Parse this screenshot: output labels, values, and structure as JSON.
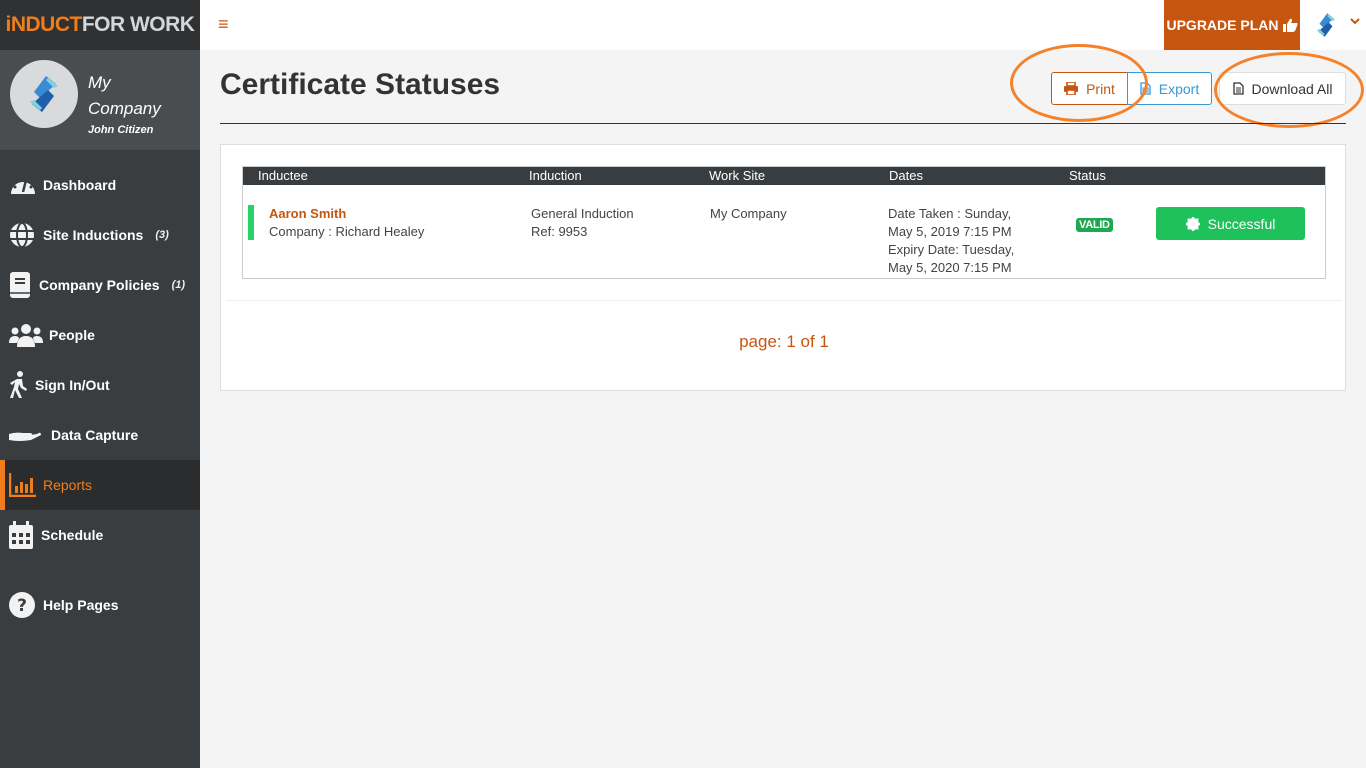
{
  "brand": {
    "part1": "iNDUCT",
    "part2": "FOR WORK"
  },
  "profile": {
    "company": "My Company",
    "user": "John Citizen"
  },
  "sidebar": {
    "items": [
      {
        "label": "Dashboard",
        "icon": "dashboard-gauge-icon",
        "count": ""
      },
      {
        "label": "Site Inductions",
        "icon": "globe-icon",
        "count": "(3)"
      },
      {
        "label": "Company Policies",
        "icon": "book-icon",
        "count": "(1)"
      },
      {
        "label": "People",
        "icon": "users-icon",
        "count": ""
      },
      {
        "label": "Sign In/Out",
        "icon": "walking-icon",
        "count": ""
      },
      {
        "label": "Data Capture",
        "icon": "hand-icon",
        "count": ""
      },
      {
        "label": "Reports",
        "icon": "bar-chart-icon",
        "count": "",
        "active": true
      },
      {
        "label": "Schedule",
        "icon": "calendar-icon",
        "count": ""
      },
      {
        "label": "Help Pages",
        "icon": "question-circle-icon",
        "count": ""
      }
    ]
  },
  "topbar": {
    "menu_icon": "≡",
    "upgrade_label": "UPGRADE PLAN"
  },
  "page": {
    "title": "Certificate Statuses",
    "actions": {
      "print": "Print",
      "export": "Export",
      "download_all": "Download All"
    }
  },
  "table": {
    "columns": [
      "Inductee",
      "Induction",
      "Work Site",
      "Dates",
      "Status"
    ],
    "rows": [
      {
        "name": "Aaron Smith",
        "company": "Company : Richard Healey",
        "induction": "General Induction",
        "ref": "Ref: 9953",
        "work_site": "My Company",
        "date_taken_1": "Date Taken : Sunday,",
        "date_taken_2": "May 5, 2019 7:15 PM",
        "expiry_1": "Expiry Date: Tuesday,",
        "expiry_2": "May 5, 2020 7:15 PM",
        "status": "VALID",
        "result": "Successful"
      }
    ]
  },
  "pagination": {
    "text": "page: 1 of 1"
  },
  "colors": {
    "accent": "#c65510",
    "brand_orange": "#f07d1c",
    "sidebar": "#3a3d3f",
    "success": "#1ec15a",
    "valid": "#1da851",
    "export_blue": "#3c97d3"
  }
}
